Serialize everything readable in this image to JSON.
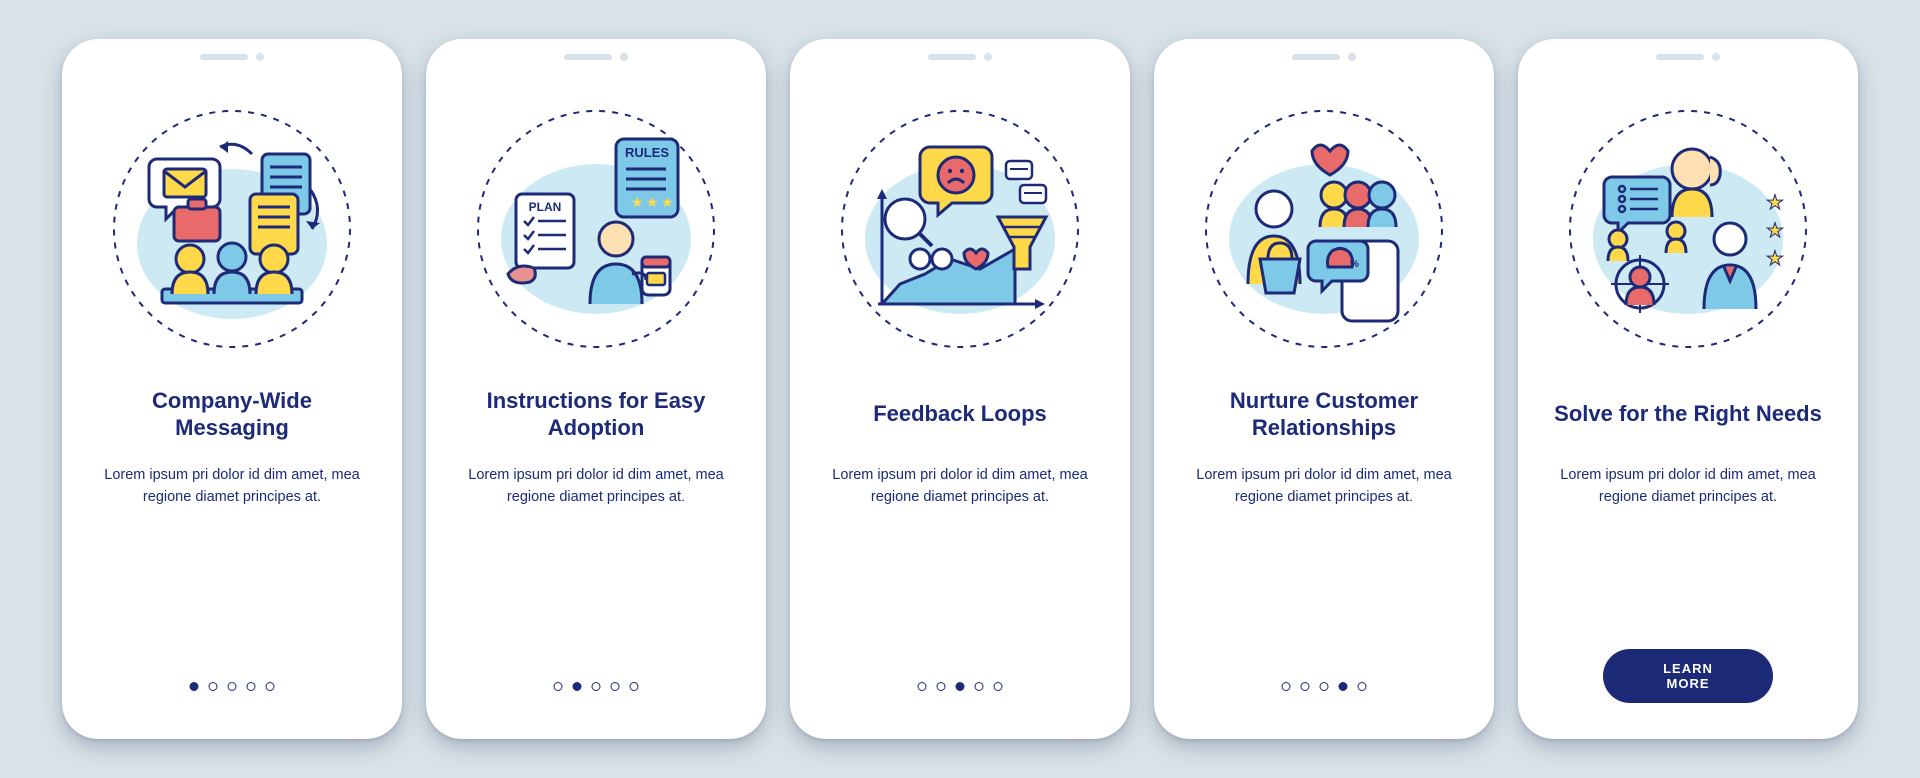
{
  "screens": [
    {
      "title": "Company-Wide Messaging",
      "body": "Lorem ipsum pri dolor id dim amet, mea regione diamet principes at.",
      "activeDot": 0,
      "hasCta": false,
      "iconName": "company-messaging-illustration"
    },
    {
      "title": "Instructions for Easy Adoption",
      "body": "Lorem ipsum pri dolor id dim amet, mea regione diamet principes at.",
      "activeDot": 1,
      "hasCta": false,
      "iconName": "instructions-illustration"
    },
    {
      "title": "Feedback Loops",
      "body": "Lorem ipsum pri dolor id dim amet, mea regione diamet principes at.",
      "activeDot": 2,
      "hasCta": false,
      "iconName": "feedback-loops-illustration"
    },
    {
      "title": "Nurture Customer Relationships",
      "body": "Lorem ipsum pri dolor id dim amet, mea regione diamet principes at.",
      "activeDot": 3,
      "hasCta": false,
      "iconName": "nurture-relationships-illustration"
    },
    {
      "title": "Solve for the Right Needs",
      "body": "Lorem ipsum pri dolor id dim amet, mea regione diamet principes at.",
      "activeDot": 4,
      "hasCta": true,
      "iconName": "right-needs-illustration"
    }
  ],
  "ctaLabel": "LEARN MORE",
  "dotCount": 5,
  "colors": {
    "navy": "#1d2a78",
    "yellow": "#ffd94a",
    "red": "#e86a6a",
    "blue": "#7ec8e8",
    "bg": "#d8e2e8"
  }
}
